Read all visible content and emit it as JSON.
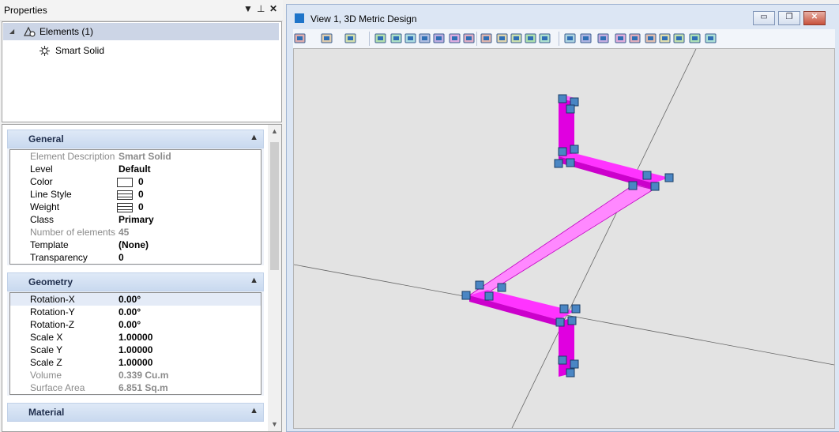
{
  "props": {
    "title": "Properties",
    "controls": {
      "menu": "▼",
      "pin": "⊥",
      "close": "✕"
    },
    "tree": {
      "root": {
        "expander": "◢",
        "icon": "elements-icon",
        "label": "Elements (1)"
      },
      "child": {
        "icon": "smart-solid-icon",
        "label": "Smart Solid"
      }
    },
    "groups": {
      "general": {
        "title": "General",
        "rows": [
          {
            "key": "Element Description",
            "value": "Smart Solid"
          },
          {
            "key": "Level",
            "value": "Default"
          },
          {
            "key": "Color",
            "value": "0"
          },
          {
            "key": "Line Style",
            "value": "0"
          },
          {
            "key": "Weight",
            "value": "0"
          },
          {
            "key": "Class",
            "value": "Primary"
          },
          {
            "key": "Number of elements",
            "value": "45"
          },
          {
            "key": "Template",
            "value": "(None)"
          },
          {
            "key": "Transparency",
            "value": "0"
          }
        ]
      },
      "geometry": {
        "title": "Geometry",
        "rows": [
          {
            "key": "Rotation-X",
            "value": "0.00°"
          },
          {
            "key": "Rotation-Y",
            "value": "0.00°"
          },
          {
            "key": "Rotation-Z",
            "value": "0.00°"
          },
          {
            "key": "Scale X",
            "value": "1.00000"
          },
          {
            "key": "Scale Y",
            "value": "1.00000"
          },
          {
            "key": "Scale Z",
            "value": "1.00000"
          },
          {
            "key": "Volume",
            "value": "0.339 Cu.m"
          },
          {
            "key": "Surface Area",
            "value": "6.851 Sq.m"
          }
        ]
      },
      "material": {
        "title": "Material"
      }
    }
  },
  "view": {
    "title": "View 1, 3D Metric Design",
    "buttons": {
      "minimize": "▭",
      "restore": "❐",
      "close": "✕"
    },
    "toolbar_icons": [
      "view-attributes-icon",
      "display-style-icon",
      "lights-icon",
      "paint-brush-icon",
      "zoom-in-icon",
      "zoom-out-icon",
      "window-area-icon",
      "fit-view-icon",
      "rotate-view-icon",
      "pan-view-icon",
      "walk-icon",
      "fly-icon",
      "view-previous-icon",
      "prev-arrow-icon",
      "next-arrow-icon",
      "copy-view-icon",
      "clip-volume-icon",
      "change-view-perspective-icon",
      "view-display-icon",
      "toggle-z-icon",
      "camera-settings-icon",
      "save-image-icon",
      "standard-view-icon",
      "clip-mask-icon",
      "view-settings-icon"
    ],
    "colors": {
      "solid": "#ff00ff",
      "solid_dark": "#d400d4",
      "solid_light": "#ff88ff",
      "handle": "#4a86c4"
    }
  }
}
